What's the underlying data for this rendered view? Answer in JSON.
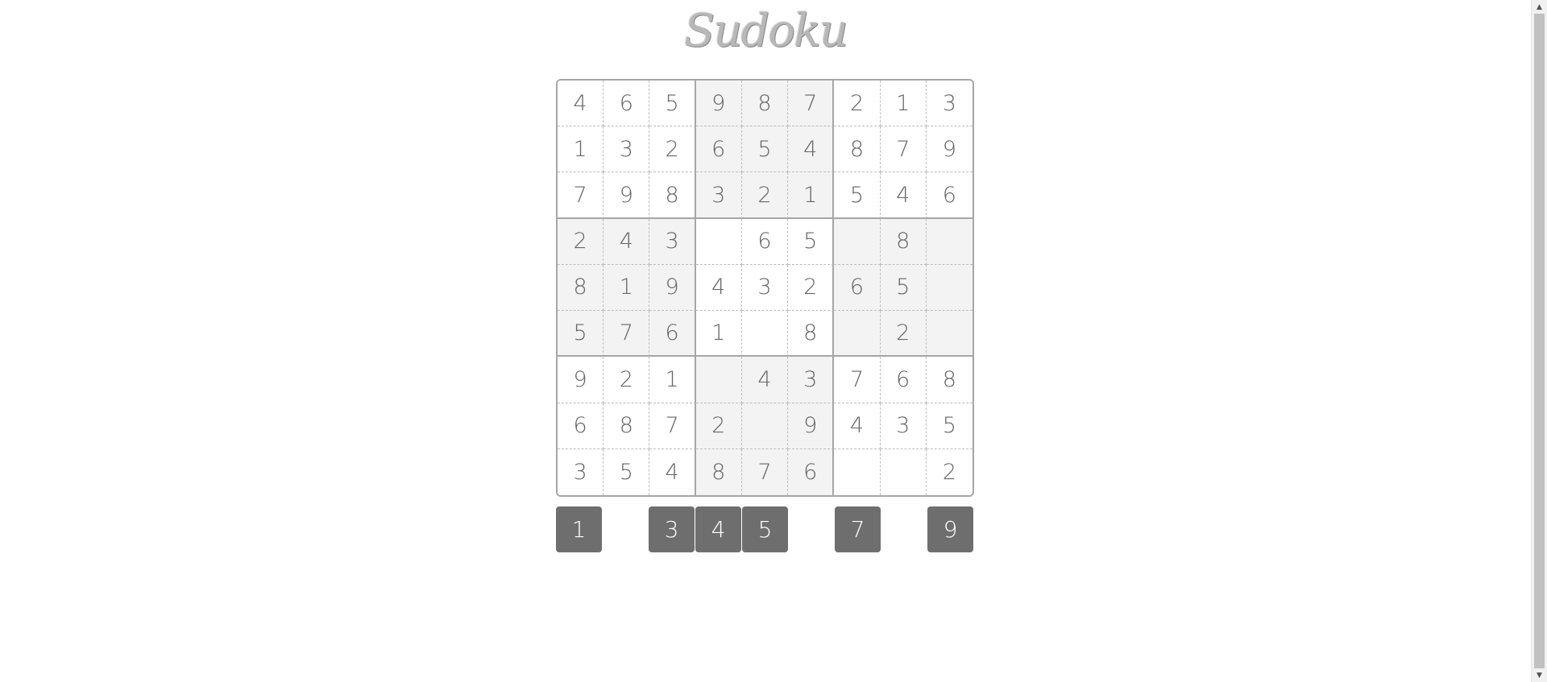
{
  "title": "Sudoku",
  "colors": {
    "cell_text": "#666666",
    "shaded_box": "#f3f3f3",
    "button_bg": "#6e6e6e",
    "button_text": "#ffffff",
    "border": "#a6a6a6"
  },
  "grid": [
    [
      "4",
      "6",
      "5",
      "9",
      "8",
      "7",
      "2",
      "1",
      "3"
    ],
    [
      "1",
      "3",
      "2",
      "6",
      "5",
      "4",
      "8",
      "7",
      "9"
    ],
    [
      "7",
      "9",
      "8",
      "3",
      "2",
      "1",
      "5",
      "4",
      "6"
    ],
    [
      "2",
      "4",
      "3",
      "",
      "6",
      "5",
      "",
      "8",
      ""
    ],
    [
      "8",
      "1",
      "9",
      "4",
      "3",
      "2",
      "6",
      "5",
      ""
    ],
    [
      "5",
      "7",
      "6",
      "1",
      "",
      "8",
      "",
      "2",
      ""
    ],
    [
      "9",
      "2",
      "1",
      "",
      "4",
      "3",
      "7",
      "6",
      "8"
    ],
    [
      "6",
      "8",
      "7",
      "2",
      "",
      "9",
      "4",
      "3",
      "5"
    ],
    [
      "3",
      "5",
      "4",
      "8",
      "7",
      "6",
      "",
      "",
      "2"
    ]
  ],
  "numpad": [
    {
      "label": "1",
      "column": 1
    },
    {
      "label": "3",
      "column": 3
    },
    {
      "label": "4",
      "column": 4
    },
    {
      "label": "5",
      "column": 5
    },
    {
      "label": "7",
      "column": 7
    },
    {
      "label": "9",
      "column": 9
    }
  ],
  "scrollbar": {
    "up_icon": "triangle-up-icon",
    "down_icon": "triangle-down-icon"
  }
}
